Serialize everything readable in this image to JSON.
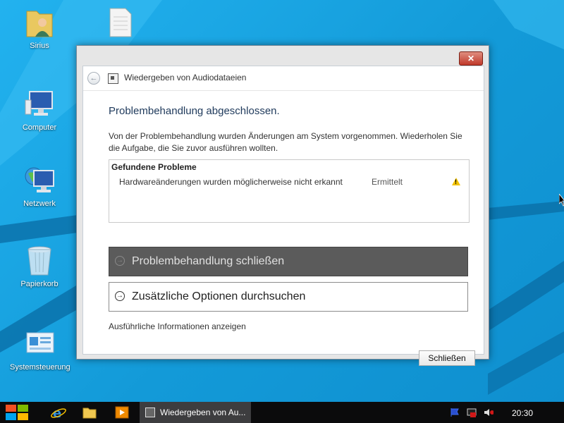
{
  "desktop": {
    "icons": [
      {
        "label": "Sirius",
        "icon": "user-folder-icon"
      },
      {
        "label": "Computer",
        "icon": "computer-icon"
      },
      {
        "label": "Netzwerk",
        "icon": "network-icon"
      },
      {
        "label": "Papierkorb",
        "icon": "recycle-bin-icon"
      },
      {
        "label": "Systemsteuerung",
        "icon": "control-panel-icon"
      }
    ]
  },
  "dialog": {
    "title": "Wiedergeben von Audiodataeien",
    "heading": "Problembehandlung abgeschlossen.",
    "description": "Von der Problembehandlung wurden Änderungen am System vorgenommen. Wiederholen Sie die Aufgabe, die Sie zuvor ausführen wollten.",
    "problems_header": "Gefundene Probleme",
    "problems": [
      {
        "name": "Hardwareänderungen wurden möglicherweise nicht erkannt",
        "status": "Ermittelt",
        "icon": "warning-icon"
      }
    ],
    "primary_command": "Problembehandlung schließen",
    "secondary_command": "Zusätzliche Optionen durchsuchen",
    "details_link": "Ausführliche Informationen anzeigen",
    "close_button": "Schließen",
    "close_glyph": "✕"
  },
  "taskbar": {
    "task_label": "Wiedergeben von Au...",
    "clock": "20:30"
  },
  "colors": {
    "desktop": "#1aa3e6",
    "taskbar": "#0b0b0c",
    "heading": "#1e395b",
    "primary_command_bg": "#5b5b5b"
  }
}
